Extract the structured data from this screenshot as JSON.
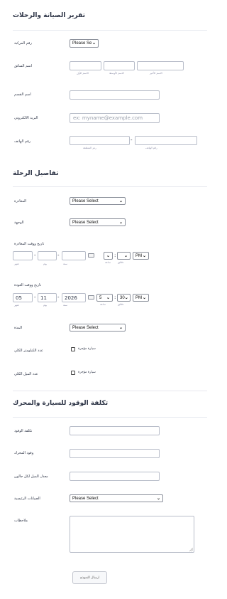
{
  "form": {
    "title": "تقرير الصيانة والرحلات",
    "vehicle_number": {
      "label": "رقم المركبة",
      "value": "Please Se"
    },
    "driver_name": {
      "label": "اسم السائق",
      "first": "الاسم الأول",
      "middle": "الاسم الأوسط",
      "last": "الاسم الأخير"
    },
    "department": {
      "label": "اسم القسم"
    },
    "email": {
      "label": "البريد الالكتروني",
      "placeholder": "ex: myname@example.com"
    },
    "phone": {
      "label": "رقم الهاتف",
      "area_code": "رمز المنطقة",
      "number": "رقم الهاتف",
      "separator": "-"
    }
  },
  "trip": {
    "title": "تفاصيل الرحلة",
    "departure": {
      "label": "المغادرة",
      "value": "Please Select"
    },
    "destination": {
      "label": "الوجهة",
      "value": "Please Select"
    },
    "departure_datetime": {
      "label": "تاريخ ووقت المغادرة",
      "month": "",
      "day": "",
      "year": "",
      "month_sub": "شهر",
      "day_sub": "يوم",
      "year_sub": "سنة",
      "hour": "",
      "minute": "",
      "ampm": "PM",
      "hour_sub": "ساعة",
      "minute_sub": "دقائق",
      "sep": "-",
      "colon": ":"
    },
    "return_datetime": {
      "label": "تاريخ ووقت العودة",
      "month": "05",
      "day": "11",
      "year": "2026",
      "month_sub": "شهر",
      "day_sub": "يوم",
      "year_sub": "سنة",
      "hour": "5",
      "minute": "30",
      "ampm": "PM",
      "hour_sub": "ساعة",
      "minute_sub": "دقائق",
      "sep": "-",
      "colon": ":"
    },
    "duration": {
      "label": "المدة",
      "value": "Please Select"
    },
    "odometer_total": {
      "label": "عدد الكيلومتر الكلي",
      "option": "سيارة مؤجرة"
    },
    "miles_total": {
      "label": "عدد الميل الكلي",
      "option": "سيارة مؤجرة"
    }
  },
  "fuel": {
    "title": "تكلفة الوقود للسيارة والمحرك",
    "fuel_cost": {
      "label": "تكلفة الوقود"
    },
    "engine_fuel": {
      "label": "وقود المحرك"
    },
    "mpg": {
      "label": "معدل الميل لكل جالون"
    },
    "main_maintenance": {
      "label": "الصيانات الرئيسية",
      "value": "Please Select"
    },
    "notes": {
      "label": "ملاحظات"
    }
  },
  "submit_label": "ارسال النموذج"
}
